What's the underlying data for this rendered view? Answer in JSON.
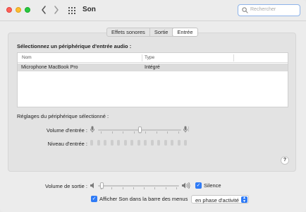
{
  "window": {
    "title": "Son"
  },
  "search": {
    "placeholder": "Rechercher"
  },
  "tabs": [
    {
      "label": "Effets sonores",
      "active": false
    },
    {
      "label": "Sortie",
      "active": false
    },
    {
      "label": "Entrée",
      "active": true
    }
  ],
  "input_section": {
    "title": "Sélectionnez un périphérique d'entrée audio :",
    "columns": [
      "Nom",
      "Type"
    ],
    "rows": [
      {
        "name": "Microphone MacBook Pro",
        "type": "Intégré",
        "selected": true
      }
    ]
  },
  "device_settings": {
    "title": "Réglages du périphérique sélectionné :",
    "input_volume_label": "Volume d'entrée :",
    "input_volume_level": 0.5,
    "input_level_label": "Niveau d'entrée :",
    "input_level_active_bars": 0
  },
  "help": {
    "label": "?"
  },
  "output": {
    "volume_label": "Volume de sortie :",
    "volume_level": 0.05,
    "mute_label": "Silence",
    "mute_checked": true
  },
  "menubar_option": {
    "label": "Afficher Son dans la barre des menus",
    "checked": true,
    "select_value": "en phase d'activité"
  },
  "colors": {
    "accent": "#2f7bf6",
    "close": "#ff5f57",
    "minimize": "#febc2e",
    "zoom": "#28c840"
  }
}
